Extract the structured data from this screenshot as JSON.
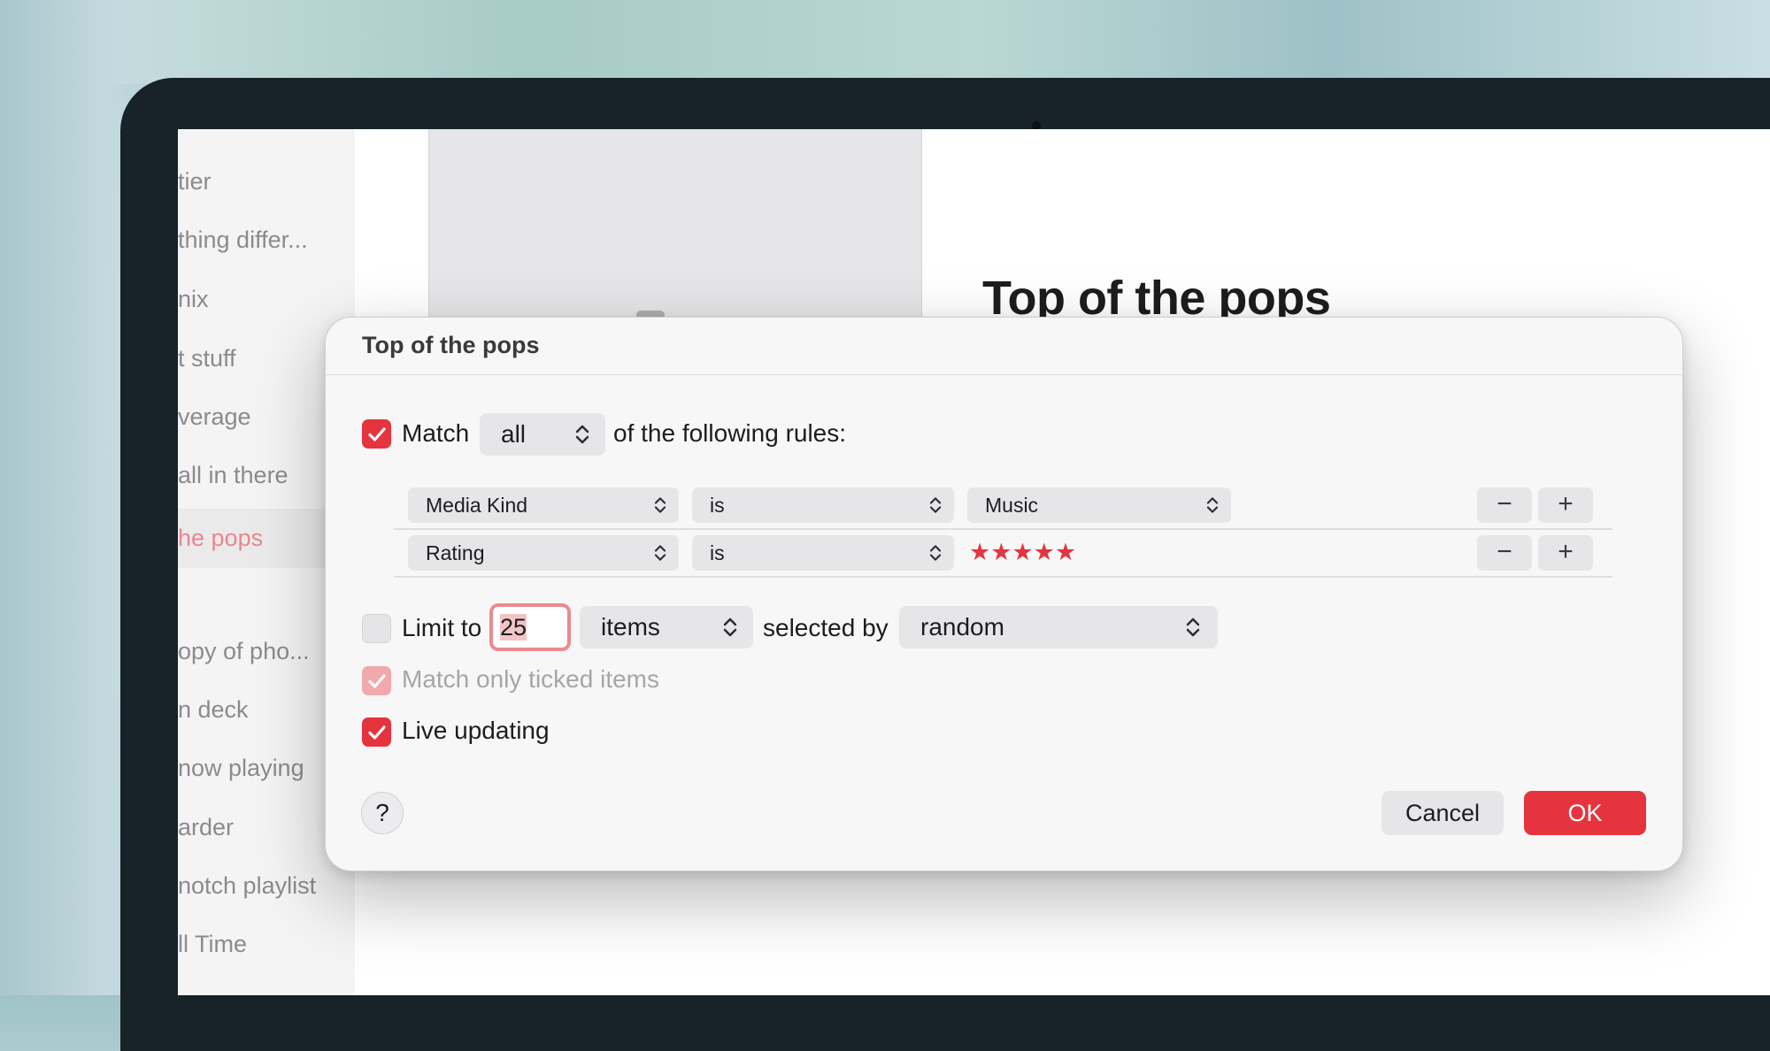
{
  "sidebar": {
    "items": [
      {
        "label": "tier"
      },
      {
        "label": "thing differ..."
      },
      {
        "label": "nix"
      },
      {
        "label": "t stuff"
      },
      {
        "label": "verage"
      },
      {
        "label": "all in there"
      },
      {
        "label": "he pops",
        "selected": true
      },
      {
        "label": "opy of pho..."
      },
      {
        "label": "n deck"
      },
      {
        "label": "now playing"
      },
      {
        "label": "arder"
      },
      {
        "label": "notch playlist"
      },
      {
        "label": "ll Time"
      }
    ]
  },
  "main": {
    "playlist_title": "Top of the pops",
    "artwork_icon": "gear-icon"
  },
  "dialog": {
    "title": "Top of the pops",
    "match": {
      "checked": true,
      "label": "Match",
      "selector_value": "all",
      "suffix": "of the following rules:"
    },
    "rules": [
      {
        "field": "Media Kind",
        "operator": "is",
        "value": "Music",
        "remove_label": "−",
        "add_label": "+"
      },
      {
        "field": "Rating",
        "operator": "is",
        "value_stars": "★★★★★",
        "rating": 5,
        "remove_label": "−",
        "add_label": "+"
      }
    ],
    "limit": {
      "checked": false,
      "label": "Limit to",
      "value": "25",
      "unit": "items",
      "selected_by_label": "selected by",
      "selected_by_value": "random"
    },
    "match_ticked": {
      "checked": true,
      "enabled": false,
      "label": "Match only ticked items"
    },
    "live_updating": {
      "checked": true,
      "label": "Live updating"
    },
    "help_label": "?",
    "cancel_label": "Cancel",
    "ok_label": "OK"
  },
  "colors": {
    "accent": "#e5343e",
    "accent_dim": "#f1a9ad",
    "sidebar_selected_text": "#e9868f"
  }
}
